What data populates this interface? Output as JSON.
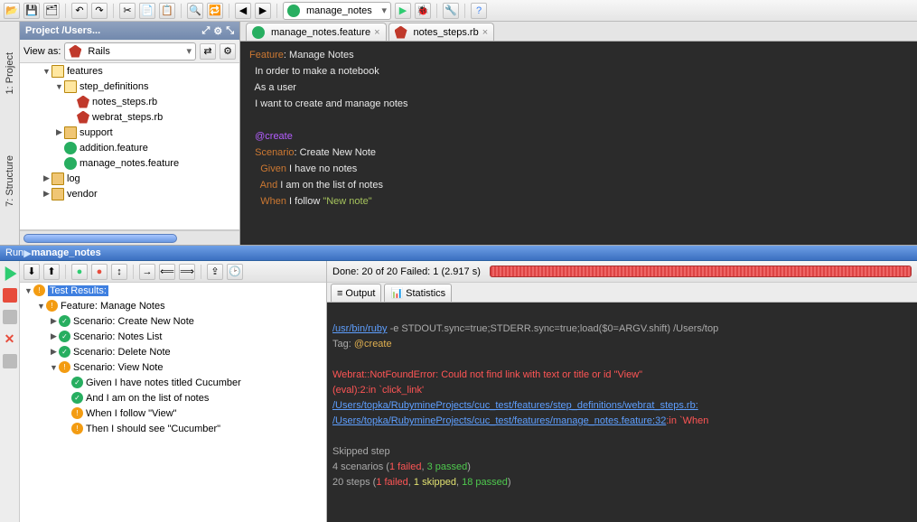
{
  "toolbar": {
    "run_config": "manage_notes"
  },
  "side_tabs": {
    "project": "1: Project",
    "structure": "7: Structure"
  },
  "project": {
    "title": "Project /Users...",
    "view_as_label": "View as:",
    "view_as_value": "Rails",
    "tree": [
      {
        "depth": 1,
        "arrow": "▼",
        "icon": "folder open",
        "label": "features"
      },
      {
        "depth": 2,
        "arrow": "▼",
        "icon": "folder open",
        "label": "step_definitions"
      },
      {
        "depth": 3,
        "arrow": "",
        "icon": "ruby",
        "label": "notes_steps.rb"
      },
      {
        "depth": 3,
        "arrow": "",
        "icon": "ruby",
        "label": "webrat_steps.rb"
      },
      {
        "depth": 2,
        "arrow": "▶",
        "icon": "folder",
        "label": "support"
      },
      {
        "depth": 2,
        "arrow": "",
        "icon": "cuke",
        "label": "addition.feature"
      },
      {
        "depth": 2,
        "arrow": "",
        "icon": "cuke",
        "label": "manage_notes.feature"
      },
      {
        "depth": 1,
        "arrow": "▶",
        "icon": "folder",
        "label": "log"
      },
      {
        "depth": 1,
        "arrow": "▶",
        "icon": "folder",
        "label": "vendor"
      }
    ]
  },
  "editor_tabs": [
    {
      "icon": "cuke",
      "label": "manage_notes.feature"
    },
    {
      "icon": "ruby",
      "label": "notes_steps.rb"
    }
  ],
  "code": {
    "l1a": "Feature",
    "l1b": ": Manage Notes",
    "l2": "  In order to make a notebook",
    "l3": "  As a user",
    "l4": "  I want to create and manage notes",
    "l5": "",
    "l6": "  @create",
    "l7a": "  Scenario",
    "l7b": ": Create New Note",
    "l8a": "    Given ",
    "l8b": "I have no notes",
    "l9a": "    And ",
    "l9b": "I am on the list of notes",
    "l10a": "    When ",
    "l10b": "I follow ",
    "l10c": "\"New note\""
  },
  "run": {
    "header_prefix": "Run ",
    "header_config": "manage_notes",
    "status": "Done: 20 of 20  Failed: 1  (2.917 s)",
    "tree_root": "Test Results:",
    "feature": "Feature: Manage Notes",
    "scenarios": [
      "Scenario: Create New Note",
      "Scenario: Notes List",
      "Scenario: Delete Note",
      "Scenario: View Note"
    ],
    "steps": [
      "Given I have notes titled Cucumber",
      "And I am on the list of notes",
      "When I follow \"View\"",
      "Then I should see \"Cucumber\""
    ],
    "tabs": {
      "output": "Output",
      "stats": "Statistics"
    },
    "console": {
      "l1a": "/usr/bin/ruby",
      "l1b": " -e STDOUT.sync=true;STDERR.sync=true;load($0=ARGV.shift) /Users/top",
      "l2a": "Tag: ",
      "l2b": "@create",
      "l3": "",
      "l4": "Webrat::NotFoundError: Could not find link with text or title or id \"View\"",
      "l5": "(eval):2:in `click_link'",
      "l6": "/Users/topka/RubymineProjects/cuc_test/features/step_definitions/webrat_steps.rb:",
      "l7a": "/Users/topka/RubymineProjects/cuc_test/features/manage_notes.feature:32",
      "l7b": ":in `When ",
      "l8": "",
      "l9": "Skipped step",
      "l10a": "4 scenarios (",
      "l10b": "1 failed",
      "l10c": ", ",
      "l10d": "3 passed",
      "l10e": ")",
      "l11a": "20 steps (",
      "l11b": "1 failed",
      "l11c": ", ",
      "l11d": "1 skipped",
      "l11e": ", ",
      "l11f": "18 passed",
      "l11g": ")"
    }
  }
}
